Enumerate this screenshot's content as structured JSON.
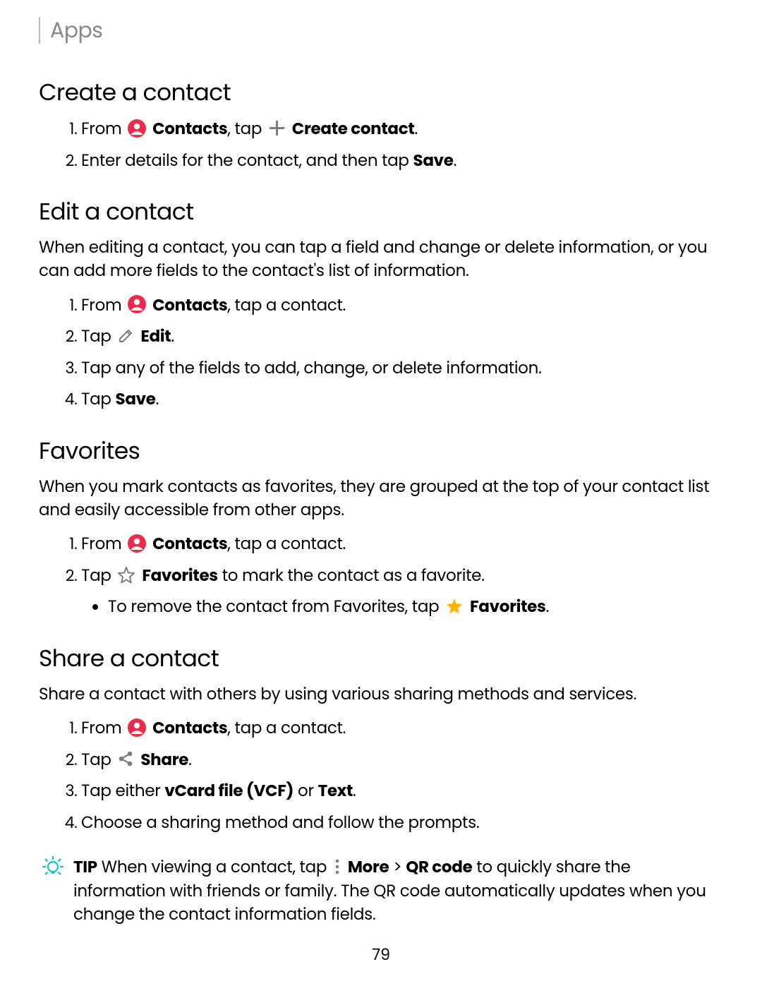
{
  "header": "Apps",
  "page_number": "79",
  "sections": {
    "create": {
      "title": "Create a contact",
      "step1_a": "From",
      "step1_b": "Contacts",
      "step1_c": ", tap",
      "step1_d": "Create contact",
      "step1_e": ".",
      "step2_a": "Enter details for the contact, and then tap ",
      "step2_b": "Save",
      "step2_c": "."
    },
    "edit": {
      "title": "Edit a contact",
      "intro": "When editing a contact, you can tap a field and change or delete information, or you can add more fields to the contact's list of information.",
      "step1_a": "From",
      "step1_b": "Contacts",
      "step1_c": ", tap a contact.",
      "step2_a": "Tap",
      "step2_b": "Edit",
      "step2_c": ".",
      "step3": "Tap any of the fields to add, change, or delete information.",
      "step4_a": "Tap ",
      "step4_b": "Save",
      "step4_c": "."
    },
    "favorites": {
      "title": "Favorites",
      "intro": "When you mark contacts as favorites, they are grouped at the top of your contact list and easily accessible from other apps.",
      "step1_a": "From",
      "step1_b": "Contacts",
      "step1_c": ", tap a contact.",
      "step2_a": "Tap",
      "step2_b": "Favorites",
      "step2_c": " to mark the contact as a favorite.",
      "sub_a": "To remove the contact from Favorites, tap",
      "sub_b": "Favorites",
      "sub_c": "."
    },
    "share": {
      "title": "Share a contact",
      "intro": "Share a contact with others by using various sharing methods and services.",
      "step1_a": "From",
      "step1_b": "Contacts",
      "step1_c": ", tap a contact.",
      "step2_a": "Tap",
      "step2_b": "Share",
      "step2_c": ".",
      "step3_a": "Tap either ",
      "step3_b": "vCard file (VCF)",
      "step3_c": " or ",
      "step3_d": "Text",
      "step3_e": ".",
      "step4": "Choose a sharing method and follow the prompts."
    },
    "tip": {
      "label": "TIP",
      "a": "  When viewing a contact, tap",
      "b": "More",
      "c": " > ",
      "d": "QR code",
      "e": " to quickly share the information with friends or family. The QR code automatically updates when you change the contact information fields."
    }
  }
}
